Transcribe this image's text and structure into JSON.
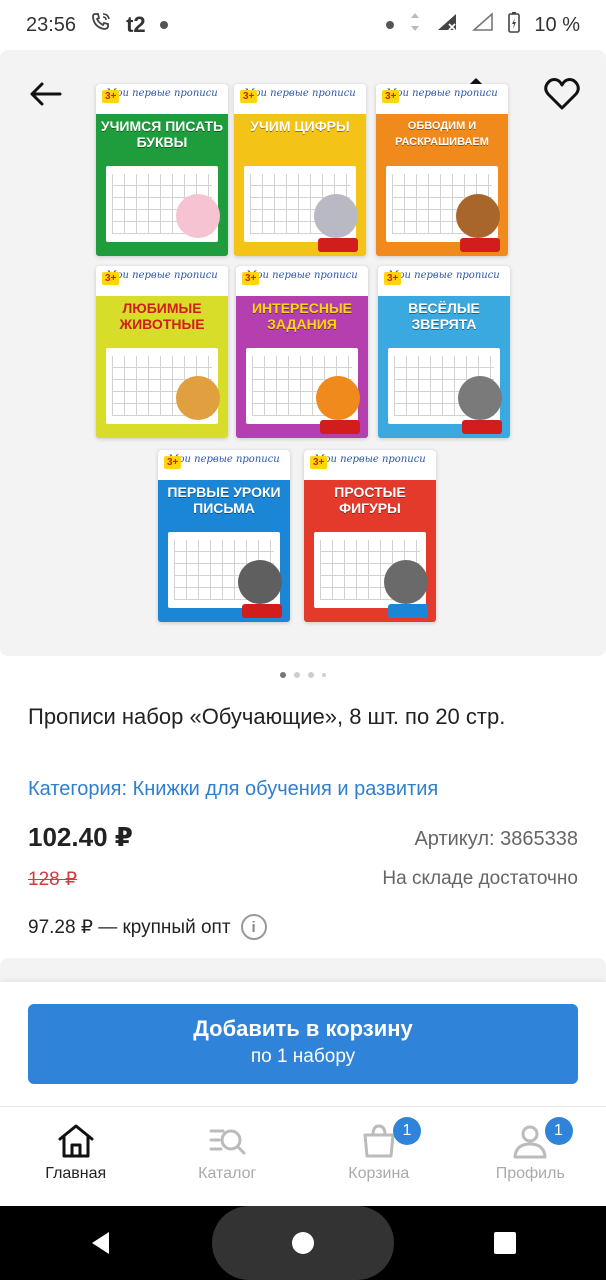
{
  "status_bar": {
    "time": "23:56",
    "carrier": "t2",
    "battery": "10 %"
  },
  "gallery": {
    "books": [
      {
        "title": "Учимся писать буквы",
        "color": "#1f9d3d"
      },
      {
        "title": "Учим цифры",
        "color": "#f3c417"
      },
      {
        "title": "Обводим и раскрашиваем",
        "color": "#f08a1c"
      },
      {
        "title": "Любимые животные",
        "color": "#d8dd2a"
      },
      {
        "title": "Интересные задания",
        "color": "#b63fb0"
      },
      {
        "title": "Весёлые зверята",
        "color": "#3aa9e0"
      },
      {
        "title": "Первые уроки письма",
        "color": "#1c86d6"
      },
      {
        "title": "Простые фигуры",
        "color": "#e43a2c"
      }
    ],
    "header_text": "Мои первые прописи",
    "age": "3+",
    "pages_total": 4,
    "current_page": 1
  },
  "product": {
    "title": "Прописи набор «Обучающие», 8 шт. по 20 стр.",
    "category": "Категория: Книжки для обучения и развития",
    "price": "102.40 ₽",
    "sku": "Артикул: 3865338",
    "old_price": "128 ₽",
    "stock": "На складе достаточно",
    "wholesale": "97.28 ₽ — крупный опт"
  },
  "cart_button": {
    "line1": "Добавить в корзину",
    "line2": "по 1 набору"
  },
  "bottom_nav": {
    "items": [
      {
        "label": "Главная"
      },
      {
        "label": "Каталог"
      },
      {
        "label": "Корзина",
        "badge": "1"
      },
      {
        "label": "Профиль",
        "badge": "1"
      }
    ]
  },
  "colors": {
    "accent": "#2f83d8",
    "old_price": "#d23b3b",
    "link": "#2f7fd0"
  }
}
